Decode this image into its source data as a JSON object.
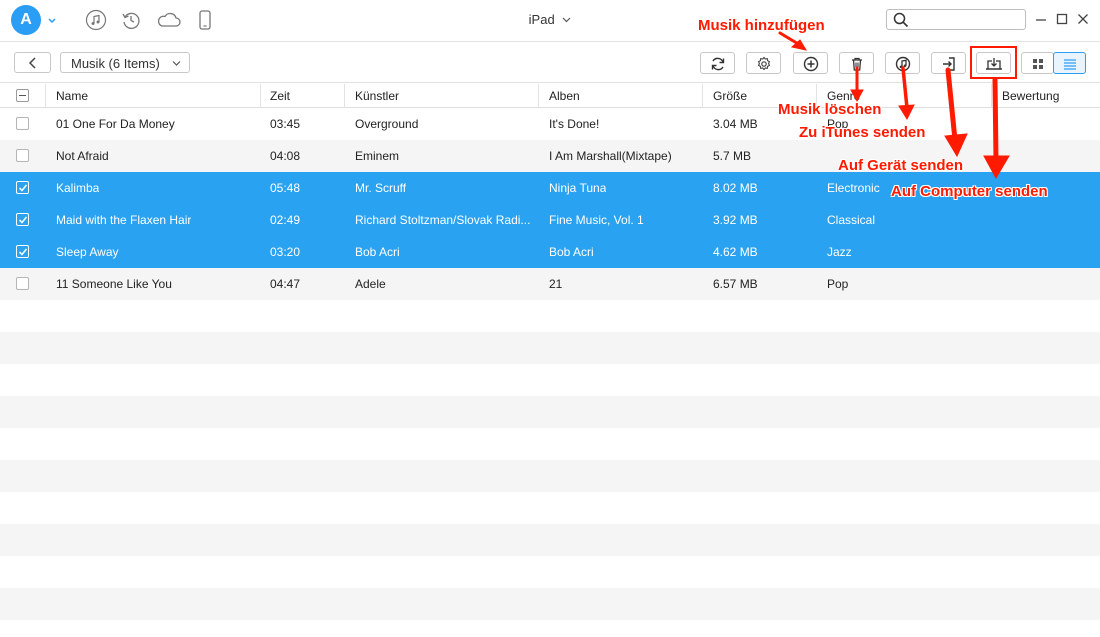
{
  "app": {
    "logo_letter": "A",
    "device_title": "iPad",
    "search": {
      "value": "",
      "placeholder": ""
    }
  },
  "topbar_icons": [
    "music-icon",
    "restore-icon",
    "cloud-icon",
    "phone-icon"
  ],
  "toolbar": {
    "category_label": "Musik (6 Items)",
    "buttons": [
      "refresh-icon",
      "settings-icon",
      "add-icon",
      "delete-icon",
      "to-itunes-icon",
      "to-device-icon",
      "to-computer-icon",
      "grid-view-icon",
      "list-view-icon"
    ]
  },
  "table": {
    "columns": [
      "Name",
      "Zeit",
      "Künstler",
      "Alben",
      "Größe",
      "Genre",
      "Bewertung"
    ],
    "rows": [
      {
        "name": "01 One For Da Money",
        "time": "03:45",
        "artist": "Overground",
        "album": "It's Done!",
        "size": "3.04 MB",
        "genre": "Pop",
        "selected": false
      },
      {
        "name": "Not Afraid",
        "time": "04:08",
        "artist": "Eminem",
        "album": "I Am Marshall(Mixtape)",
        "size": "5.7 MB",
        "genre": "",
        "selected": false
      },
      {
        "name": "Kalimba",
        "time": "05:48",
        "artist": "Mr. Scruff",
        "album": "Ninja Tuna",
        "size": "8.02 MB",
        "genre": "Electronic",
        "selected": true
      },
      {
        "name": "Maid with the Flaxen Hair",
        "time": "02:49",
        "artist": "Richard Stoltzman/Slovak Radi...",
        "album": "Fine Music, Vol. 1",
        "size": "3.92 MB",
        "genre": "Classical",
        "selected": true
      },
      {
        "name": "Sleep Away",
        "time": "03:20",
        "artist": "Bob Acri",
        "album": "Bob Acri",
        "size": "4.62 MB",
        "genre": "Jazz",
        "selected": true
      },
      {
        "name": "11 Someone Like You",
        "time": "04:47",
        "artist": "Adele",
        "album": "21",
        "size": "6.57 MB",
        "genre": "Pop",
        "selected": false
      }
    ]
  },
  "annotations": {
    "add": "Musik hinzufügen",
    "delete": "Musik löschen",
    "itunes": "Zu iTunes senden",
    "device": "Auf Gerät senden",
    "computer": "Auf Computer senden"
  },
  "colors": {
    "accent": "#2aa2f2",
    "annotation": "#ff1a00",
    "alt_row": "#f5f5f5"
  }
}
